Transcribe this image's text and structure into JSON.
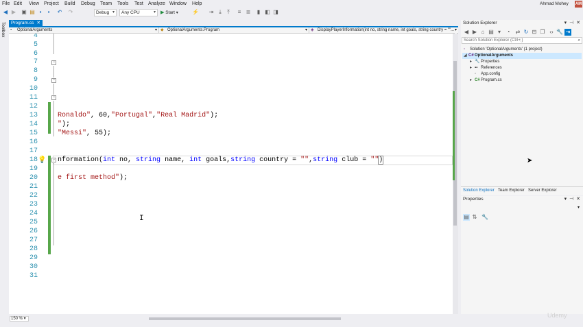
{
  "menu": {
    "items": [
      "File",
      "Edit",
      "View",
      "Project",
      "Build",
      "Debug",
      "Team",
      "Tools",
      "Test",
      "Analyze",
      "Window",
      "Help"
    ],
    "user": "Ahmad Mohey",
    "avatar_initials": "AM"
  },
  "toolbar": {
    "config_combo": "Debug",
    "platform_combo": "Any CPU",
    "start_label": "Start"
  },
  "toolbox_label": "Toolbox",
  "document": {
    "tab_label": "Program.cs",
    "tab_close": "✕",
    "nav": {
      "project": "OptionalArguments",
      "type": "OptionalArguments.Program",
      "member": "DisplayPlayerInformation(int no, string name, int goals, string country = \"\"..."
    }
  },
  "editor": {
    "line_numbers": [
      "4",
      "5",
      "6",
      "7",
      "8",
      "9",
      "10",
      "11",
      "12",
      "13",
      "14",
      "15",
      "16",
      "17",
      "18",
      "19",
      "20",
      "21",
      "22",
      "23",
      "24",
      "25",
      "26",
      "27",
      "28",
      "29",
      "30",
      "31"
    ],
    "line13": {
      "a": "Ronaldo\"",
      "b": ", 60,",
      "c": "\"Portugal\"",
      "d": ",",
      "e": "\"Real Madrid\"",
      "f": ");"
    },
    "line14": {
      "a": "\"",
      "b": ");"
    },
    "line15": {
      "a": "\"Messi\"",
      "b": ", 55);"
    },
    "line18": {
      "a": "nformation(",
      "kw1": "int",
      "b": " no, ",
      "kw2": "string",
      "c": " name, ",
      "kw3": "int",
      "d": " goals,",
      "kw4": "string",
      "e": " country = ",
      "s1": "\"\"",
      "f": ",",
      "kw5": "string",
      "g": " club = ",
      "s2": "\"\"",
      "h": ")"
    },
    "line20": {
      "a": "e first method\"",
      "b": ");"
    },
    "zoom": "150 %"
  },
  "solution_explorer": {
    "title": "Solution Explorer",
    "search_placeholder": "Search Solution Explorer (Ctrl+;)",
    "solution": "Solution 'OptionalArguments' (1 project)",
    "project": "OptionalArguments",
    "items": [
      "Properties",
      "References",
      "App.config",
      "Program.cs"
    ],
    "tabs": [
      "Solution Explorer",
      "Team Explorer",
      "Server Explorer"
    ]
  },
  "properties": {
    "title": "Properties"
  },
  "colors": {
    "accent": "#007acc",
    "change_bar": "#57a64a",
    "keyword": "#0000ff",
    "string": "#a31515",
    "line_number": "#2b91af"
  },
  "watermark": "Udemy"
}
